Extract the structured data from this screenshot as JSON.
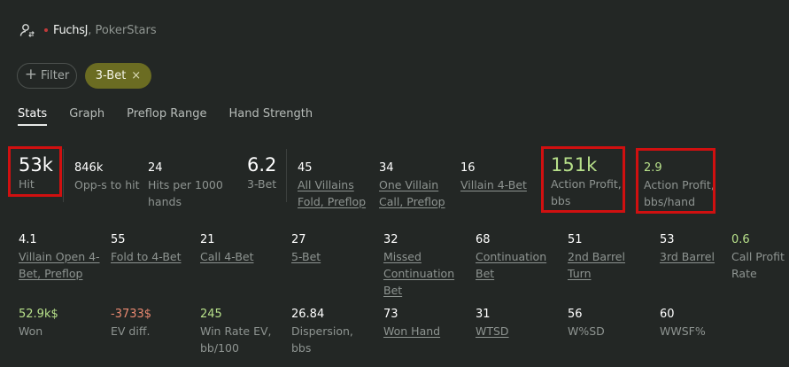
{
  "header": {
    "player": "FuchsJ",
    "site": ", PokerStars",
    "icon": "user-switch-icon",
    "status_color": "#c03a3a"
  },
  "filter": {
    "label": "Filter",
    "icon": "plus-icon"
  },
  "chip": {
    "label": "3-Bet",
    "close": "×",
    "color": "#6b6c22"
  },
  "tabs": [
    {
      "label": "Stats",
      "active": true
    },
    {
      "label": "Graph"
    },
    {
      "label": "Preflop Range"
    },
    {
      "label": "Hand Strength"
    }
  ],
  "summary": [
    {
      "value": "53k",
      "label": "Hit"
    },
    {
      "value": "846k",
      "label": "Opp-s to hit"
    },
    {
      "value": "24",
      "label": "Hits per 1000 hands"
    },
    {
      "value": "6.2",
      "label": "3-Bet"
    },
    {
      "value": "45",
      "label": "All Villains Fold, Preflop"
    },
    {
      "value": "34",
      "label": "One Villain Call, Preflop"
    },
    {
      "value": "16",
      "label": "Villain 4-Bet"
    },
    {
      "value": "151k",
      "label": "Action Profit, bbs"
    },
    {
      "value": "2.9",
      "label": "Action Profit, bbs/hand"
    }
  ],
  "row2": [
    {
      "value": "4.1",
      "label": "Villain Open 4-Bet, Preflop"
    },
    {
      "value": "55",
      "label": "Fold to 4-Bet"
    },
    {
      "value": "21",
      "label": "Call 4-Bet"
    },
    {
      "value": "27",
      "label": "5-Bet"
    },
    {
      "value": "32",
      "label": "Missed Continuation Bet"
    },
    {
      "value": "68",
      "label": "Continuation Bet"
    },
    {
      "value": "51",
      "label": "2nd Barrel Turn"
    },
    {
      "value": "53",
      "label": "3rd Barrel"
    },
    {
      "value": "0.6",
      "label": "Call Profit Rate"
    }
  ],
  "row3": [
    {
      "value": "52.9k$",
      "label": "Won"
    },
    {
      "value": "-3733$",
      "label": "EV diff."
    },
    {
      "value": "245",
      "label": "Win Rate EV, bb/100"
    },
    {
      "value": "26.84",
      "label": "Dispersion, bbs"
    },
    {
      "value": "73",
      "label": "Won Hand"
    },
    {
      "value": "31",
      "label": "WTSD"
    },
    {
      "value": "56",
      "label": "W%SD"
    },
    {
      "value": "60",
      "label": "WWSF%"
    }
  ],
  "colors": {
    "positive": "#b7e08a",
    "negative": "#e88870",
    "highlight_box": "#d01010"
  }
}
